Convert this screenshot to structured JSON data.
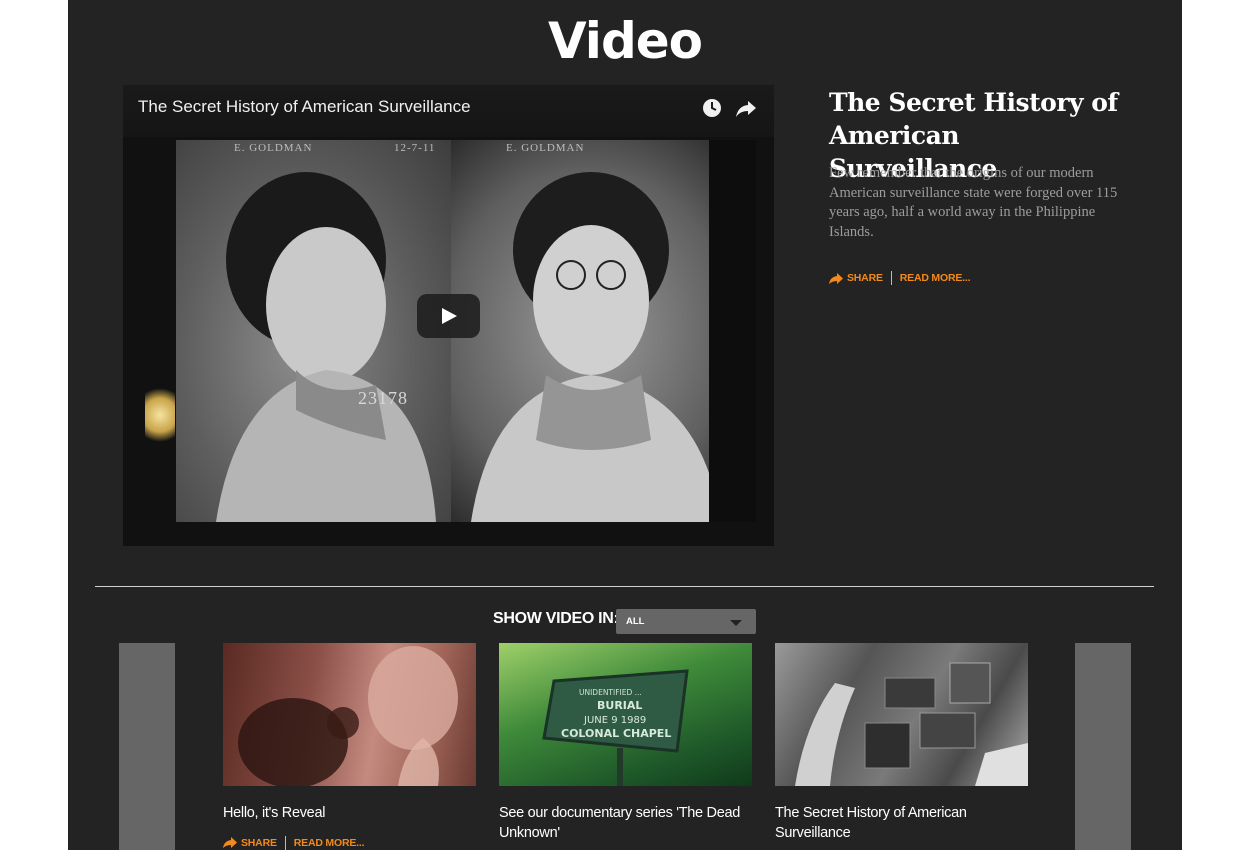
{
  "page": {
    "title": "Video"
  },
  "player": {
    "title": "The Secret History of American Surveillance",
    "frame_label_left": "E. GOLDMAN",
    "frame_label_mid": "12-7-11",
    "frame_label_right": "E. GOLDMAN",
    "photo_number": "23178"
  },
  "featured": {
    "headline": "The Secret History of American Surveillance",
    "description": "Few remember that the origins of our modern American surveillance state were forged over 115 years ago, half a world away in the Philippine Islands.",
    "share_label": "SHARE",
    "read_more_label": "READ MORE..."
  },
  "filter": {
    "label": "SHOW VIDEO IN:",
    "selected": "ALL"
  },
  "cards": [
    {
      "title": "Hello, it's Reveal",
      "share_label": "SHARE",
      "read_more_label": "READ MORE..."
    },
    {
      "title": "See our documentary series 'The Dead Unknown'",
      "sign_line1": "UNIDENTIFIED ...",
      "sign_line2": "BURIAL",
      "sign_line3": "JUNE 9 1989",
      "sign_line4": "COLONAL CHAPEL"
    },
    {
      "title": "The Secret History of American Surveillance"
    }
  ],
  "colors": {
    "accent": "#f28a1c",
    "page_bg": "#232323",
    "text_muted": "#9d9d9d"
  }
}
